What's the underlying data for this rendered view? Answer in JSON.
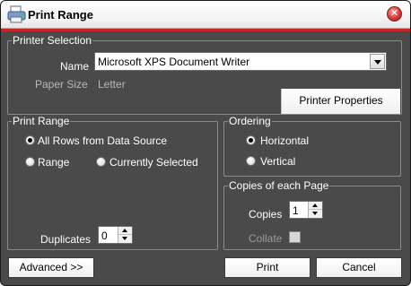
{
  "window": {
    "title": "Print Range"
  },
  "printer_selection": {
    "legend": "Printer Selection",
    "name_label": "Name",
    "name_value": "Microsoft XPS Document Writer",
    "paper_size_label": "Paper Size",
    "paper_size_value": "Letter",
    "properties_button": "Printer Properties"
  },
  "print_range": {
    "legend": "Print Range",
    "options": [
      {
        "label": "All Rows from Data Source",
        "checked": true
      },
      {
        "label": "Range",
        "checked": false
      },
      {
        "label": "Currently Selected",
        "checked": false
      }
    ],
    "duplicates_label": "Duplicates",
    "duplicates_value": "0"
  },
  "ordering": {
    "legend": "Ordering",
    "options": [
      {
        "label": "Horizontal",
        "checked": true
      },
      {
        "label": "Vertical",
        "checked": false
      }
    ]
  },
  "copies": {
    "legend": "Copies of each Page",
    "copies_label": "Copies",
    "copies_value": "1",
    "collate_label": "Collate",
    "collate_enabled": false
  },
  "buttons": {
    "advanced": "Advanced >>",
    "print": "Print",
    "cancel": "Cancel"
  }
}
